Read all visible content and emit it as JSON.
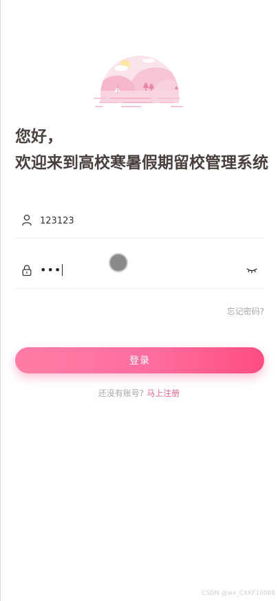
{
  "header": {
    "greeting_line1": "您好，",
    "greeting_line2": "欢迎来到高校寒暑假期留校管理系统"
  },
  "form": {
    "username_value": "123123",
    "password_mask": "•••",
    "forgot_label": "忘记密码?",
    "login_label": "登录"
  },
  "footer": {
    "no_account_text": "还没有账号?",
    "register_label": "马上注册",
    "watermark": "CSDN @wx_CXKF10088"
  },
  "colors": {
    "brand_pink": "#ff6d9e",
    "link_pink": "#e0648f",
    "title_text": "#4a3f3f"
  }
}
